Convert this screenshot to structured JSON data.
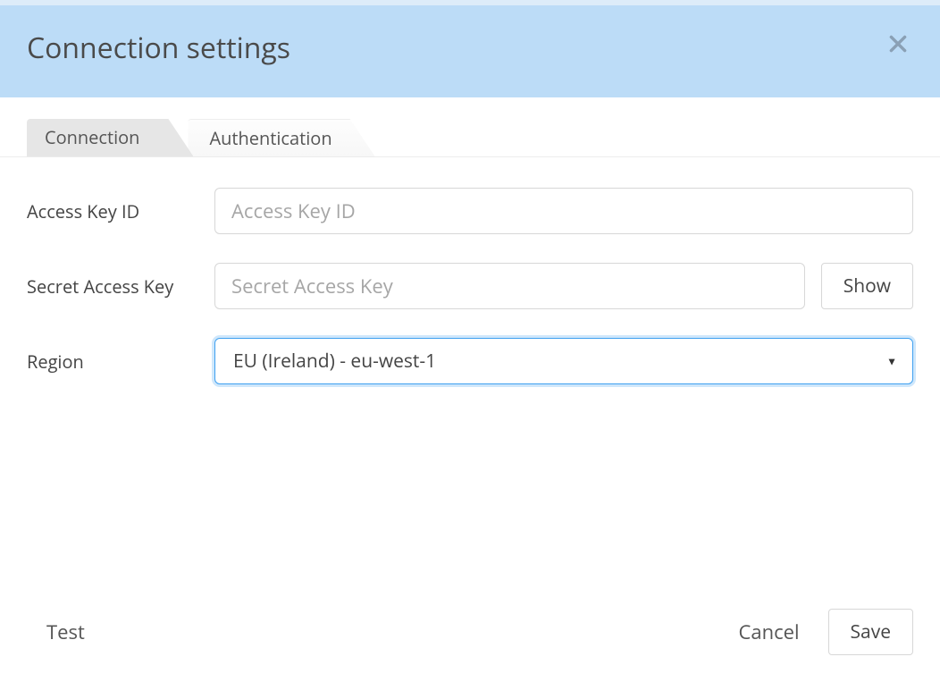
{
  "dialog": {
    "title": "Connection settings"
  },
  "tabs": {
    "connection": "Connection",
    "authentication": "Authentication"
  },
  "form": {
    "access_key_id": {
      "label": "Access Key ID",
      "placeholder": "Access Key ID",
      "value": ""
    },
    "secret_access_key": {
      "label": "Secret Access Key",
      "placeholder": "Secret Access Key",
      "value": ""
    },
    "show_button": "Show",
    "region": {
      "label": "Region",
      "selected": "EU (Ireland) - eu-west-1"
    }
  },
  "footer": {
    "test": "Test",
    "cancel": "Cancel",
    "save": "Save"
  }
}
